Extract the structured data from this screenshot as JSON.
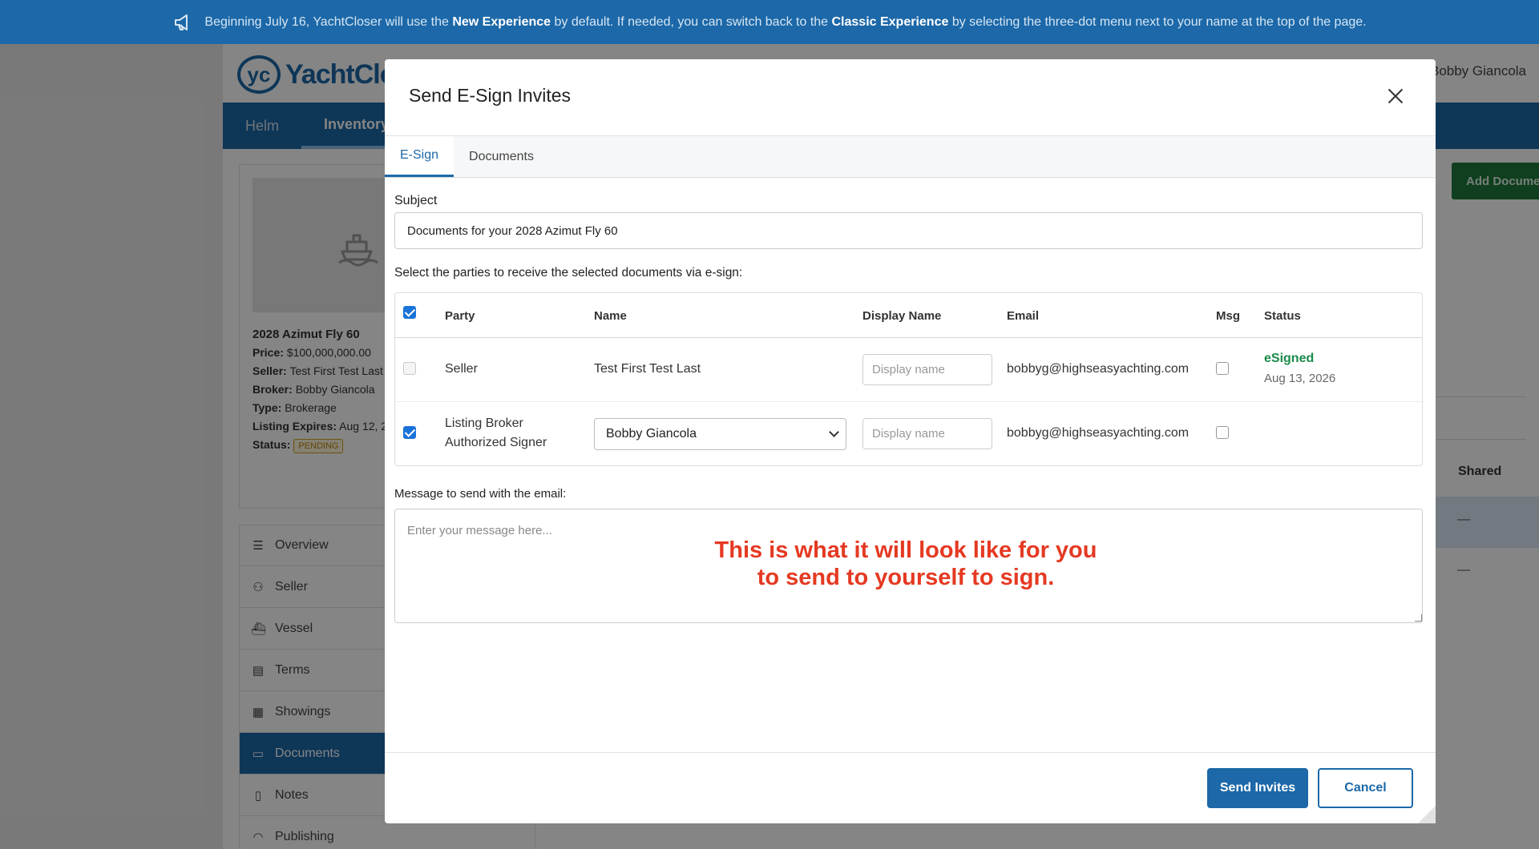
{
  "banner": {
    "text_1": "Beginning July 16, YachtCloser will use the ",
    "bold_1": "New Experience",
    "text_2": " by default. If needed, you can switch back to the ",
    "bold_2": "Classic Experience",
    "text_3": " by selecting the three-dot menu next to your name at the top of the page.",
    "icon": "megaphone-icon"
  },
  "app": {
    "logo_mark": "yc",
    "logo_text": "YachtClos",
    "user_name": ", Bobby Giancola",
    "nav": [
      "Helm",
      "Inventory"
    ],
    "listing": {
      "title": "2028 Azimut Fly 60",
      "price_label": "Price:",
      "price": "$100,000,000.00",
      "seller_label": "Seller:",
      "seller": "Test First Test Last",
      "broker_label": "Broker:",
      "broker": "Bobby Giancola",
      "type_label": "Type:",
      "type": "Brokerage",
      "expires_label": "Listing Expires:",
      "expires": "Aug 12, 2",
      "status_label": "Status:",
      "status": "PENDING"
    },
    "sidenav": [
      {
        "label": "Overview",
        "icon": "list-icon"
      },
      {
        "label": "Seller",
        "icon": "person-icon"
      },
      {
        "label": "Vessel",
        "icon": "ship-icon"
      },
      {
        "label": "Terms",
        "icon": "document-icon"
      },
      {
        "label": "Showings",
        "icon": "calendar-icon"
      },
      {
        "label": "Documents",
        "icon": "folder-icon"
      },
      {
        "label": "Notes",
        "icon": "note-icon"
      },
      {
        "label": "Publishing",
        "icon": "rss-icon"
      }
    ],
    "add_document": "Add Docume",
    "shared_header": "Shared",
    "dash": "—"
  },
  "modal": {
    "title": "Send E-Sign Invites",
    "tabs": [
      "E-Sign",
      "Documents"
    ],
    "subject_label": "Subject",
    "subject_value": "Documents for your 2028 Azimut Fly 60",
    "parties_label": "Select the parties to receive the selected documents via e-sign:",
    "columns": {
      "party": "Party",
      "name": "Name",
      "display_name": "Display Name",
      "email": "Email",
      "msg": "Msg",
      "status": "Status"
    },
    "rows": [
      {
        "party": "Seller",
        "name": "Test First Test Last",
        "display_placeholder": "Display name",
        "email": "bobbyg@highseasyachting.com",
        "status": "eSigned",
        "status_date": "Aug 13, 2026"
      },
      {
        "party_line1": "Listing Broker",
        "party_line2": "Authorized Signer",
        "name_selected": "Bobby Giancola",
        "display_placeholder": "Display name",
        "email": "bobbyg@highseasyachting.com"
      }
    ],
    "message_label": "Message to send with the email:",
    "message_placeholder": "Enter your message here...",
    "annotation_line1": "This is what it will look like for you",
    "annotation_line2": "to send to yourself to sign.",
    "send_button": "Send Invites",
    "cancel_button": "Cancel"
  },
  "colors": {
    "brand": "#1c68a8",
    "esigned": "#1a8a4a",
    "annotation": "#e53922",
    "add_button": "#1e7a3a"
  }
}
